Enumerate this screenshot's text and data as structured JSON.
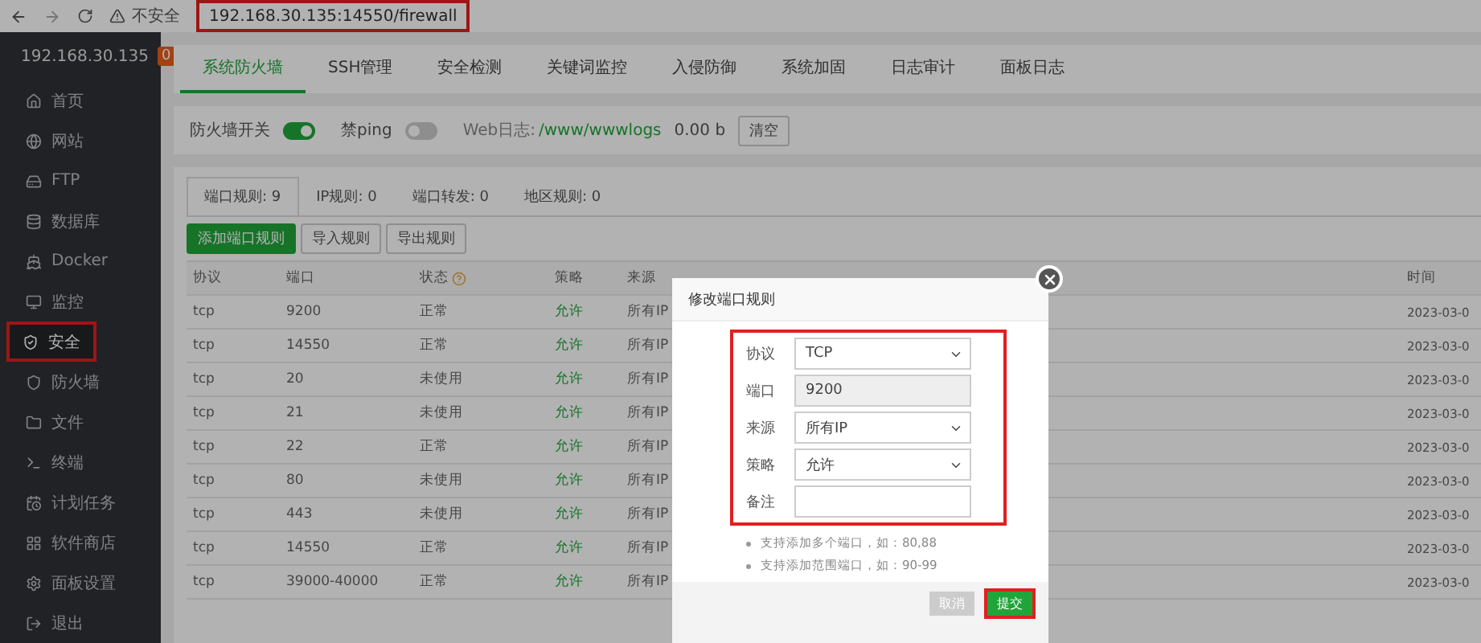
{
  "browser": {
    "insecure_label": "不安全",
    "address": "192.168.30.135:14550/firewall",
    "highlighted": true
  },
  "sidebar": {
    "server": "192.168.30.135",
    "badge": "0",
    "items": [
      {
        "label": "首页",
        "selected": false,
        "highlighted": false
      },
      {
        "label": "网站",
        "selected": false,
        "highlighted": false
      },
      {
        "label": "FTP",
        "selected": false,
        "highlighted": false
      },
      {
        "label": "数据库",
        "selected": false,
        "highlighted": false
      },
      {
        "label": "Docker",
        "selected": false,
        "highlighted": false
      },
      {
        "label": "监控",
        "selected": false,
        "highlighted": false
      },
      {
        "label": "安全",
        "selected": true,
        "highlighted": true
      },
      {
        "label": "防火墙",
        "selected": false,
        "highlighted": false
      },
      {
        "label": "文件",
        "selected": false,
        "highlighted": false
      },
      {
        "label": "终端",
        "selected": false,
        "highlighted": false
      },
      {
        "label": "计划任务",
        "selected": false,
        "highlighted": false
      },
      {
        "label": "软件商店",
        "selected": false,
        "highlighted": false
      },
      {
        "label": "面板设置",
        "selected": false,
        "highlighted": false
      },
      {
        "label": "退出",
        "selected": false,
        "highlighted": false
      }
    ]
  },
  "tabs": [
    {
      "label": "系统防火墙",
      "selected": true
    },
    {
      "label": "SSH管理",
      "selected": false
    },
    {
      "label": "安全检测",
      "selected": false
    },
    {
      "label": "关键词监控",
      "selected": false
    },
    {
      "label": "入侵防御",
      "selected": false
    },
    {
      "label": "系统加固",
      "selected": false
    },
    {
      "label": "日志审计",
      "selected": false
    },
    {
      "label": "面板日志",
      "selected": false
    }
  ],
  "controls": {
    "firewall_label": "防火墙开关",
    "firewall_on": true,
    "ping_label": "禁ping",
    "ping_on": false,
    "weblog_label": "Web日志:",
    "weblog_path": "/www/wwwlogs",
    "weblog_size": "0.00 b",
    "clear_button": "清空"
  },
  "subtabs": [
    {
      "label": "端口规则: 9",
      "selected": true
    },
    {
      "label": "IP规则: 0",
      "selected": false
    },
    {
      "label": "端口转发: 0",
      "selected": false
    },
    {
      "label": "地区规则: 0",
      "selected": false
    }
  ],
  "actions": [
    {
      "label": "添加端口规则",
      "kind": "primary"
    },
    {
      "label": "导入规则",
      "kind": "default"
    },
    {
      "label": "导出规则",
      "kind": "default"
    }
  ],
  "table": {
    "columns": [
      "协议",
      "端口",
      "状态",
      "策略",
      "来源",
      "时间"
    ],
    "rows": [
      [
        "tcp",
        "9200",
        "正常",
        "允许",
        "所有IP",
        "2023-03-0"
      ],
      [
        "tcp",
        "14550",
        "正常",
        "允许",
        "所有IP",
        "2023-03-0"
      ],
      [
        "tcp",
        "20",
        "未使用",
        "允许",
        "所有IP",
        "2023-03-0"
      ],
      [
        "tcp",
        "21",
        "未使用",
        "允许",
        "所有IP",
        "2023-03-0"
      ],
      [
        "tcp",
        "22",
        "正常",
        "允许",
        "所有IP",
        "2023-03-0"
      ],
      [
        "tcp",
        "80",
        "未使用",
        "允许",
        "所有IP",
        "2023-03-0"
      ],
      [
        "tcp",
        "443",
        "未使用",
        "允许",
        "所有IP",
        "2023-03-0"
      ],
      [
        "tcp",
        "14550",
        "正常",
        "允许",
        "所有IP",
        "2023-03-0"
      ],
      [
        "tcp",
        "39000-40000",
        "正常",
        "允许",
        "所有IP",
        "2023-03-0"
      ]
    ]
  },
  "dialog": {
    "title": "修改端口规则",
    "highlighted": true,
    "fields": [
      {
        "label": "协议",
        "kind": "select",
        "value": "TCP",
        "disabled": false
      },
      {
        "label": "端口",
        "kind": "input",
        "value": "9200",
        "disabled": true
      },
      {
        "label": "来源",
        "kind": "select",
        "value": "所有IP",
        "disabled": false
      },
      {
        "label": "策略",
        "kind": "select",
        "value": "允许",
        "disabled": false
      },
      {
        "label": "备注",
        "kind": "input",
        "disabled": false
      }
    ],
    "notes": [
      "支持添加多个端口，如：80,88",
      "支持添加范围端口，如：90-99"
    ],
    "buttons": [
      {
        "label": "取消",
        "kind": "default",
        "highlighted": false
      },
      {
        "label": "提交",
        "kind": "primary",
        "highlighted": true
      }
    ]
  }
}
